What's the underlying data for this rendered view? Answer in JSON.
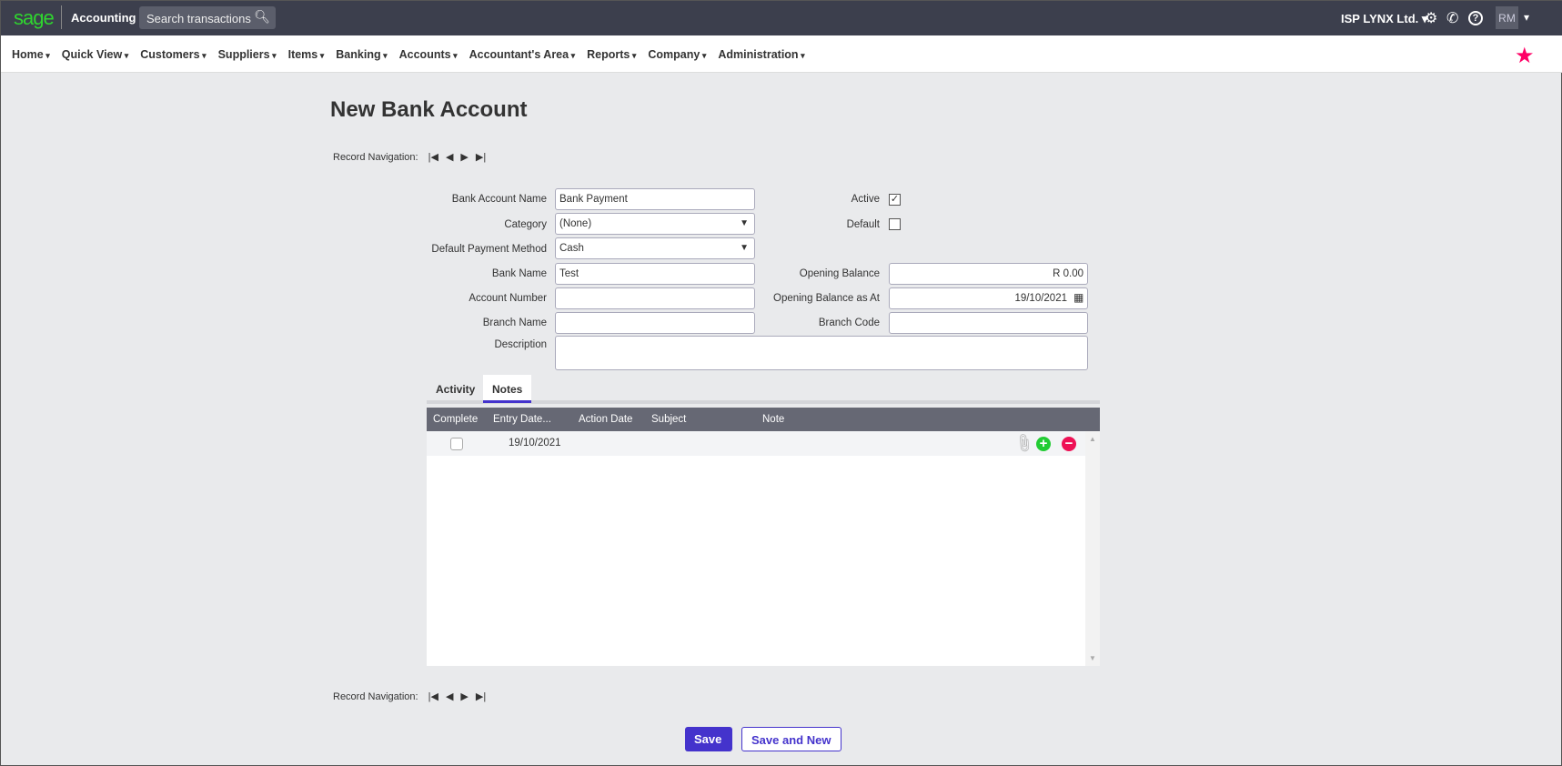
{
  "topbar": {
    "logo": "sage",
    "app": "Accounting",
    "search_placeholder": "Search transactions",
    "company": "ISP LYNX Ltd.",
    "avatar": "RM"
  },
  "nav": [
    "Home",
    "Quick View",
    "Customers",
    "Suppliers",
    "Items",
    "Banking",
    "Accounts",
    "Accountant's Area",
    "Reports",
    "Company",
    "Administration"
  ],
  "page": {
    "title": "New Bank Account",
    "record_nav_label": "Record Navigation:"
  },
  "form": {
    "bank_account_name": {
      "label": "Bank Account Name",
      "value": "Bank Payment"
    },
    "category": {
      "label": "Category",
      "value": "(None)"
    },
    "default_payment_method": {
      "label": "Default Payment Method",
      "value": "Cash"
    },
    "bank_name": {
      "label": "Bank Name",
      "value": "Test"
    },
    "account_number": {
      "label": "Account Number",
      "value": ""
    },
    "branch_name": {
      "label": "Branch Name",
      "value": ""
    },
    "description": {
      "label": "Description",
      "value": ""
    },
    "active": {
      "label": "Active",
      "checked": true
    },
    "default": {
      "label": "Default",
      "checked": false
    },
    "opening_balance": {
      "label": "Opening Balance",
      "value": "R 0.00"
    },
    "opening_balance_as_at": {
      "label": "Opening Balance as At",
      "value": "19/10/2021"
    },
    "branch_code": {
      "label": "Branch Code",
      "value": ""
    }
  },
  "tabs": [
    "Activity",
    "Notes"
  ],
  "active_tab": "Notes",
  "grid": {
    "columns": [
      "Complete",
      "Entry Date...",
      "Action Date",
      "Subject",
      "Note"
    ],
    "rows": [
      {
        "complete": false,
        "entry_date": "19/10/2021",
        "action_date": "",
        "subject": "",
        "note": ""
      }
    ]
  },
  "buttons": {
    "save": "Save",
    "save_new": "Save and New"
  },
  "colors": {
    "accent": "#4433cc",
    "brand": "#2fd52f",
    "star": "#ff0066"
  }
}
